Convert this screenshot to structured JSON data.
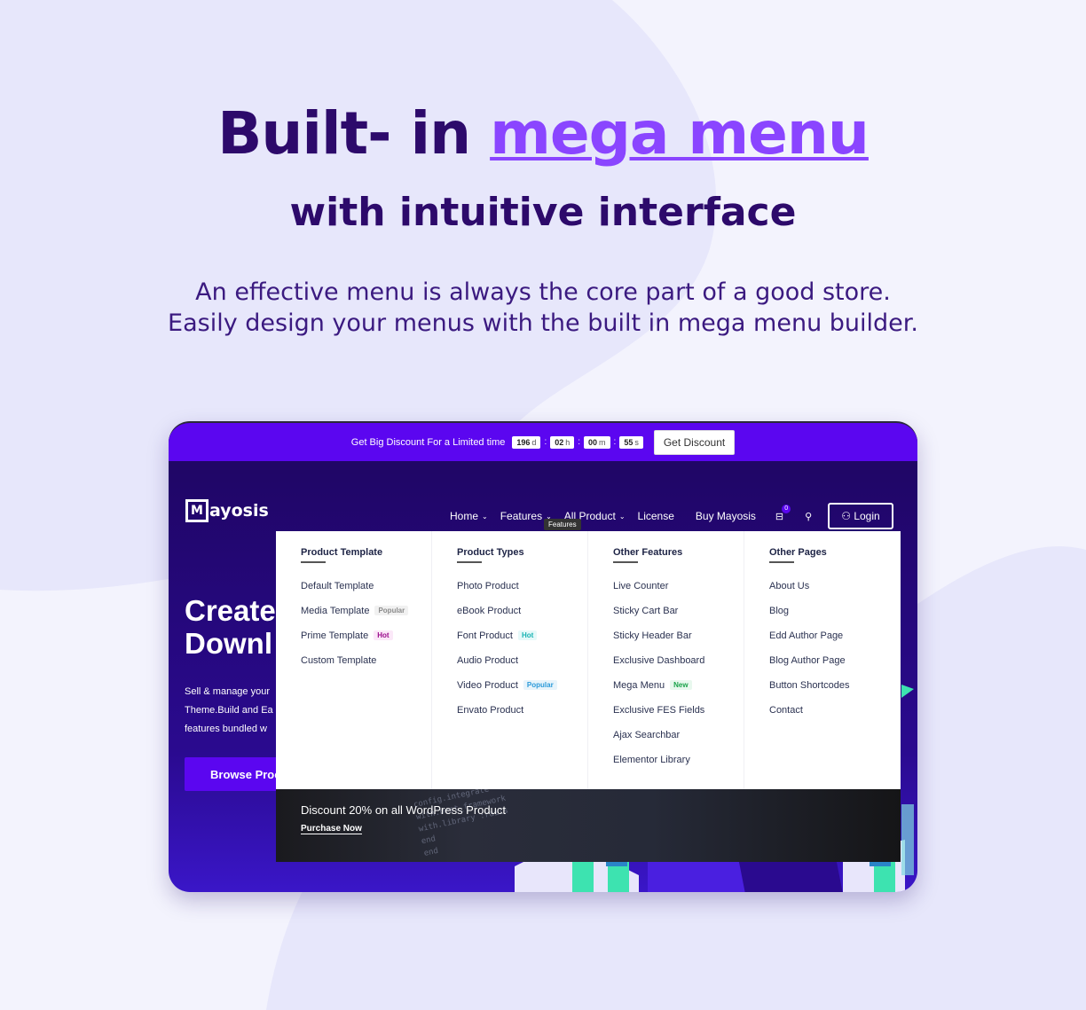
{
  "page": {
    "headline_prefix": "Built- in ",
    "headline_accent": "mega menu",
    "subhead": "with intuitive interface",
    "description_line1": "An effective menu is always the core part of a good store.",
    "description_line2": "Easily design your menus with the built in mega menu builder.",
    "colors": {
      "background": "#f3f3fd",
      "heading": "#2d0a6b",
      "accent": "#8a45ff",
      "brand_purple": "#5b06f0"
    }
  },
  "preview": {
    "promo_bar": {
      "text": "Get Big Discount For a Limited time",
      "countdown": [
        {
          "value": "196",
          "unit": "d"
        },
        {
          "value": "02",
          "unit": "h"
        },
        {
          "value": "00",
          "unit": "m"
        },
        {
          "value": "55",
          "unit": "s"
        }
      ],
      "separator": ":",
      "button_label": "Get Discount"
    },
    "logo": {
      "mark": "M",
      "text": "ayosis"
    },
    "nav": {
      "items": [
        {
          "label": "Home",
          "icon": "chevron-down-icon",
          "glyph": "⌄"
        },
        {
          "label": "Features",
          "icon": "chevron-down-icon",
          "glyph": "⌄"
        },
        {
          "label": "All Product",
          "icon": "chevron-down-icon",
          "glyph": "⌄"
        },
        {
          "label": "License"
        },
        {
          "label": "Buy Mayosis"
        }
      ],
      "cart_icon": "⊟",
      "cart_count": "0",
      "search_icon": "⚲",
      "login_icon": "⚇",
      "login_label": "Login",
      "tooltip": "Features"
    },
    "hero": {
      "title_line1": "Create",
      "title_line2": "Downl",
      "text_line1": "Sell & manage your",
      "text_line2": "Theme.Build and Ea",
      "text_line3": "features bundled w",
      "button_label": "Browse Proc"
    },
    "mega_menu": {
      "columns": [
        {
          "title": "Product Template",
          "items": [
            {
              "label": "Default Template"
            },
            {
              "label": "Media Template",
              "tag": "Popular",
              "tag_color": "#8a8a8a",
              "tag_bg": "#f1f1f1"
            },
            {
              "label": "Prime Template",
              "tag": "Hot",
              "tag_color": "#9b0a8c",
              "tag_bg": "#fbe8f8"
            },
            {
              "label": "Custom Template"
            }
          ]
        },
        {
          "title": "Product Types",
          "items": [
            {
              "label": "Photo Product"
            },
            {
              "label": "eBook Product"
            },
            {
              "label": "Font Product",
              "tag": "Hot",
              "tag_color": "#17b3b3",
              "tag_bg": "#e6f9f9"
            },
            {
              "label": "Audio Product"
            },
            {
              "label": "Video Product",
              "tag": "Popular",
              "tag_color": "#2a9ad9",
              "tag_bg": "#e8f4fb"
            },
            {
              "label": "Envato Product"
            }
          ]
        },
        {
          "title": "Other Features",
          "items": [
            {
              "label": "Live Counter"
            },
            {
              "label": "Sticky Cart Bar"
            },
            {
              "label": "Sticky Header Bar"
            },
            {
              "label": "Exclusive Dashboard"
            },
            {
              "label": "Mega Menu",
              "tag": "New",
              "tag_color": "#1aa34a",
              "tag_bg": "#e8f8ee"
            },
            {
              "label": "Exclusive FES Fields"
            },
            {
              "label": "Ajax Searchbar"
            },
            {
              "label": "Elementor Library"
            }
          ]
        },
        {
          "title": "Other Pages",
          "items": [
            {
              "label": "About Us"
            },
            {
              "label": "Blog"
            },
            {
              "label": "Edd Author Page"
            },
            {
              "label": "Blog Author Page"
            },
            {
              "label": "Button Shortcodes"
            },
            {
              "label": "Contact"
            }
          ]
        }
      ],
      "footer": {
        "text": "Discount 20% on all WordPress Product",
        "link": "Purchase Now"
      }
    }
  }
}
